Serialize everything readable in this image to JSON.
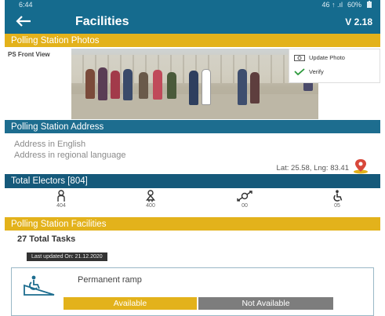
{
  "status_bar": {
    "time": "6:44",
    "indicators": "46 ↑ .ıl",
    "battery": "60%"
  },
  "header": {
    "title": "Facilities",
    "version": "V 2.18",
    "back_icon": "arrow-left-icon"
  },
  "photos": {
    "section_title": "Polling Station Photos",
    "photo_label": "PS Front View",
    "menu": {
      "update_photo": "Update Photo",
      "verify": "Verify"
    }
  },
  "address": {
    "section_title": "Polling Station Address",
    "english": "Address in English",
    "regional": "Address in regional language",
    "latlng": "Lat: 25.58, Lng: 83.41",
    "pin_icon": "map-pin-icon"
  },
  "factors": {
    "section_title": "Total Electors [804]",
    "items": [
      {
        "icon": "male-icon",
        "value": "404"
      },
      {
        "icon": "female-icon",
        "value": "400"
      },
      {
        "icon": "transgender-icon",
        "value": "00"
      },
      {
        "icon": "wheelchair-icon",
        "value": "05"
      }
    ]
  },
  "facilities": {
    "section_title": "Polling Station Facilities",
    "total_tasks": "27 Total Tasks",
    "updated": "Last updated On: 21.12.2020",
    "card": {
      "name": "Permanent ramp",
      "icon": "ramp-icon",
      "options": {
        "available": "Available",
        "not_available": "Not Available"
      }
    }
  },
  "colors": {
    "primary_blue": "#156b8e",
    "accent_yellow": "#e3b21b",
    "grey_option": "#7d7d7d"
  }
}
